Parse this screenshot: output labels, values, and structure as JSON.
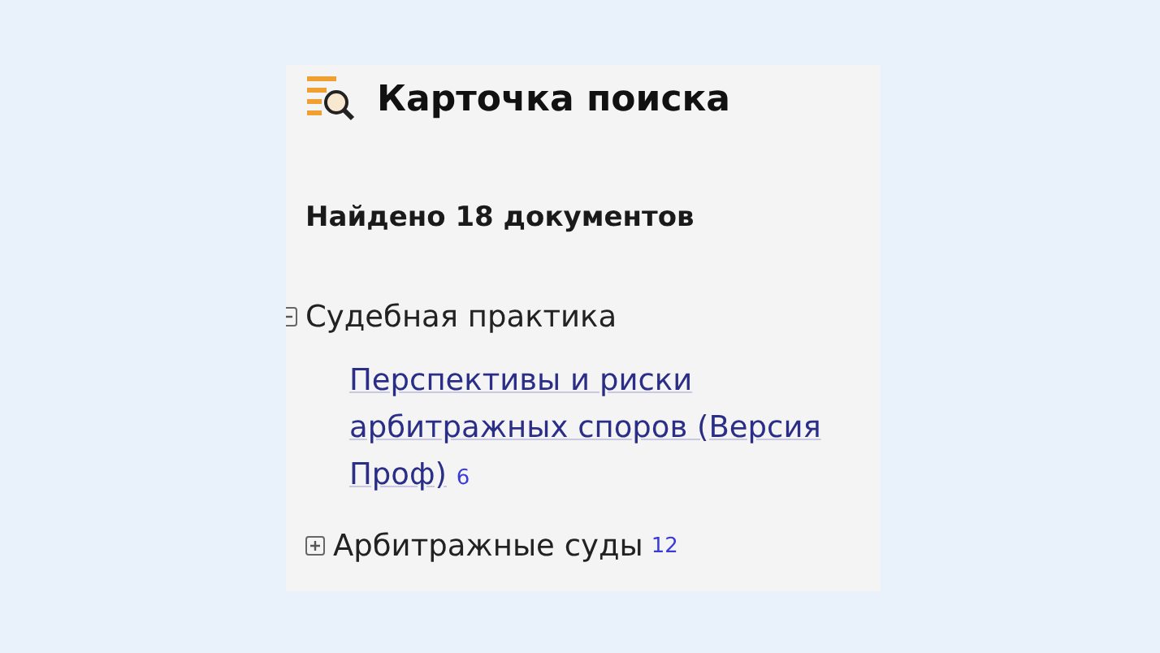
{
  "header": {
    "title": "Карточка поиска"
  },
  "summary": "Найдено 18 документов",
  "tree": [
    {
      "label": "Судебная практика",
      "expanded": true,
      "children": [
        {
          "label": "Перспективы и риски арбитражных споров (Версия Проф)",
          "count": "6"
        }
      ]
    },
    {
      "label": "Арбитражные суды",
      "count": "12",
      "expanded": false
    }
  ]
}
